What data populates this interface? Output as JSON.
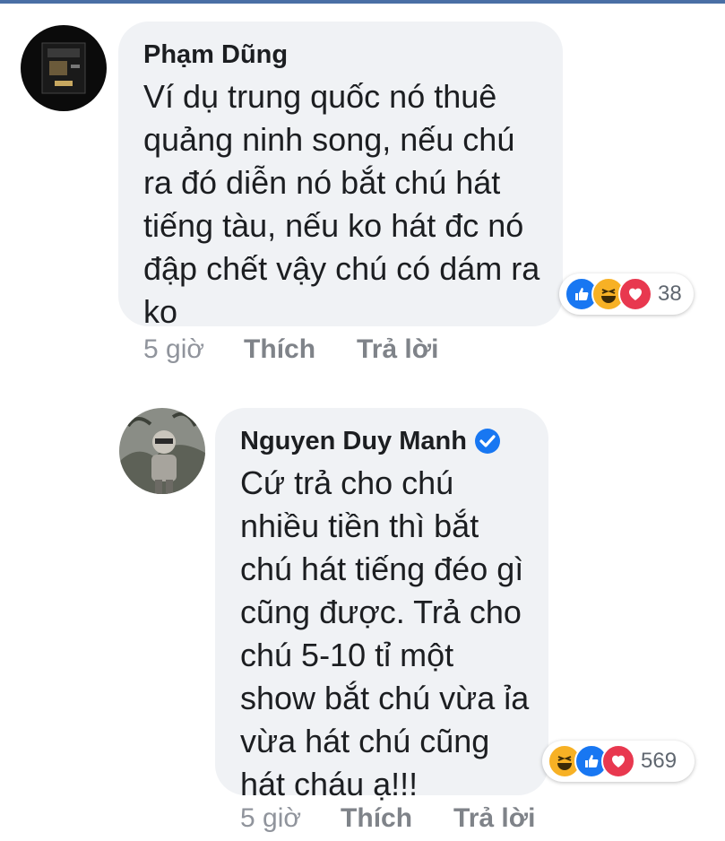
{
  "comments": [
    {
      "author": "Phạm Dũng",
      "verified": false,
      "lines": [
        "Ví dụ trung quốc nó thuê",
        "quảng ninh song, nếu chú",
        "ra đó diễn nó bắt chú hát",
        "tiếng tàu, nếu ko hát đc nó",
        "đập chết vậy chú có dám ra",
        "ko"
      ],
      "reactions": [
        "like-icon",
        "haha-icon",
        "love-icon"
      ],
      "reaction_count": "38",
      "time": "5 giờ",
      "like_label": "Thích",
      "reply_label": "Trả lời"
    },
    {
      "author": "Nguyen Duy Manh",
      "verified": true,
      "lines": [
        "Cứ trả cho chú",
        "nhiều tiền thì bắt",
        "chú hát tiếng đéo gì",
        "cũng được. Trả cho",
        "chú 5-10 tỉ một",
        "show bắt chú vừa ỉa",
        "vừa hát chú cũng",
        "hát cháu ạ!!!"
      ],
      "reactions": [
        "haha-icon",
        "like-icon",
        "love-icon"
      ],
      "reaction_count": "569",
      "time": "5 giờ",
      "like_label": "Thích",
      "reply_label": "Trả lời"
    }
  ],
  "colors": {
    "bubble": "#f0f2f5",
    "like": "#1877f2",
    "love": "#e8384f",
    "haha": "#f7b125",
    "verified": "#1877f2",
    "muted": "#90949c"
  }
}
